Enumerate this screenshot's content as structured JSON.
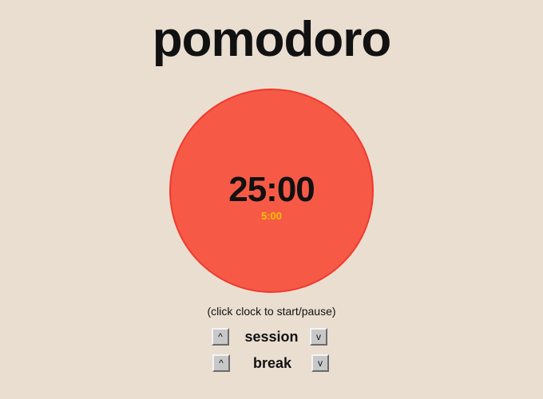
{
  "app": {
    "title": "pomodoro"
  },
  "clock": {
    "time": "25:00",
    "break_time": "5:00",
    "hint": "(click clock to start/pause)"
  },
  "session": {
    "label": "session",
    "up_label": "^",
    "down_label": "v"
  },
  "break": {
    "label": "break",
    "up_label": "^",
    "down_label": "v"
  },
  "colors": {
    "background": "#eaded1",
    "clock_fill": "#f65a46",
    "clock_border": "#ef3a2e",
    "break_time_text": "#f7c200"
  }
}
